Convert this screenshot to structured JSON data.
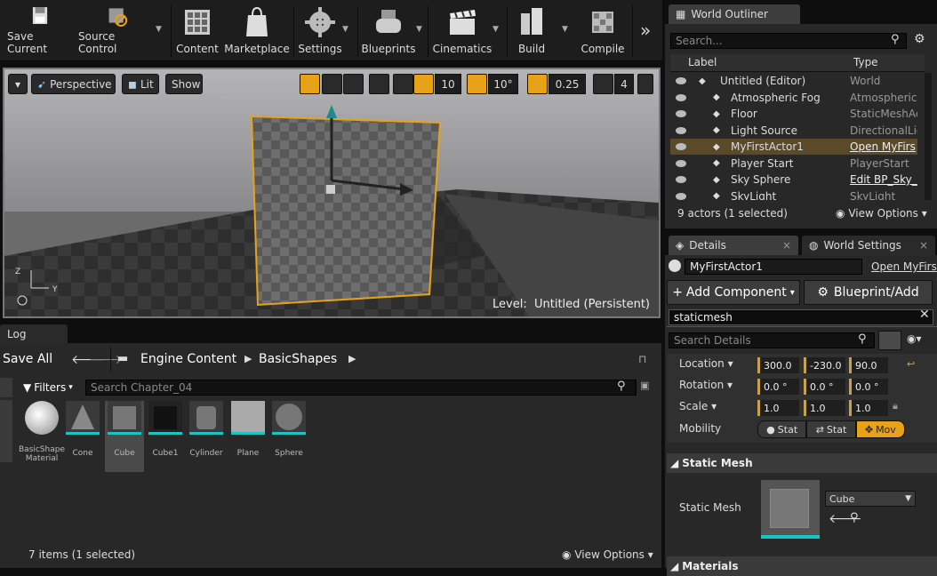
{
  "toolbar": {
    "buttons": [
      "Save Current",
      "Source Control",
      "Content",
      "Marketplace",
      "Settings",
      "Blueprints",
      "Cinematics",
      "Build",
      "Compile"
    ],
    "more": "»"
  },
  "viewport": {
    "perspective": "Perspective",
    "lit": "Lit",
    "show": "Show",
    "grid_snap": "10",
    "rot_snap": "10°",
    "scale_snap": "0.25",
    "cam_speed": "4",
    "level_label": "Level:",
    "level_name": "Untitled (Persistent)"
  },
  "outliner": {
    "tab": "World Outliner",
    "search_placeholder": "Search...",
    "col_label": "Label",
    "col_type": "Type",
    "rows": [
      {
        "label": "Untitled (Editor)",
        "type": "World",
        "selected": false
      },
      {
        "label": "Atmospheric Fog",
        "type": "AtmosphericF",
        "selected": false
      },
      {
        "label": "Floor",
        "type": "StaticMeshAc",
        "selected": false
      },
      {
        "label": "Light Source",
        "type": "DirectionalLig",
        "selected": false
      },
      {
        "label": "MyFirstActor1",
        "type": "Open MyFirs",
        "selected": true
      },
      {
        "label": "Player Start",
        "type": "PlayerStart",
        "selected": false
      },
      {
        "label": "Sky Sphere",
        "type": "Edit BP_Sky_",
        "selected": false
      },
      {
        "label": "SkyLight",
        "type": "SkyLight",
        "selected": false
      }
    ],
    "status": "9 actors (1 selected)",
    "view_options": "View Options"
  },
  "details": {
    "tab": "Details",
    "tab2": "World Settings",
    "actor_name": "MyFirstActor1",
    "open_link": "Open MyFirs",
    "add_component": "Add Component",
    "blueprint_add": "Blueprint/Add",
    "component_search": "staticmesh",
    "search_placeholder": "Search Details",
    "location_label": "Location",
    "location": [
      "300.0",
      "-230.0",
      "90.0"
    ],
    "rotation_label": "Rotation",
    "rotation": [
      "0.0 °",
      "0.0 °",
      "0.0 °"
    ],
    "scale_label": "Scale",
    "scale": [
      "1.0",
      "1.0",
      "1.0"
    ],
    "mobility_label": "Mobility",
    "mobility": [
      "Stat",
      "Stat",
      "Mov"
    ],
    "static_mesh_section": "Static Mesh",
    "static_mesh_label": "Static Mesh",
    "mesh_value": "Cube",
    "materials_section": "Materials"
  },
  "content_browser": {
    "log_tab": "Log",
    "save_all": "Save All",
    "path": [
      "Engine Content",
      "BasicShapes"
    ],
    "filters": "Filters",
    "search_placeholder": "Search Chapter_04",
    "assets": [
      "BasicShape Material",
      "Cone",
      "Cube",
      "Cube1",
      "Cylinder",
      "Plane",
      "Sphere"
    ],
    "status": "7 items (1 selected)",
    "view_options": "View Options"
  },
  "colors": {
    "accent": "#e8a21a",
    "cyan": "#19c4c4",
    "select": "#5a4a2a"
  }
}
